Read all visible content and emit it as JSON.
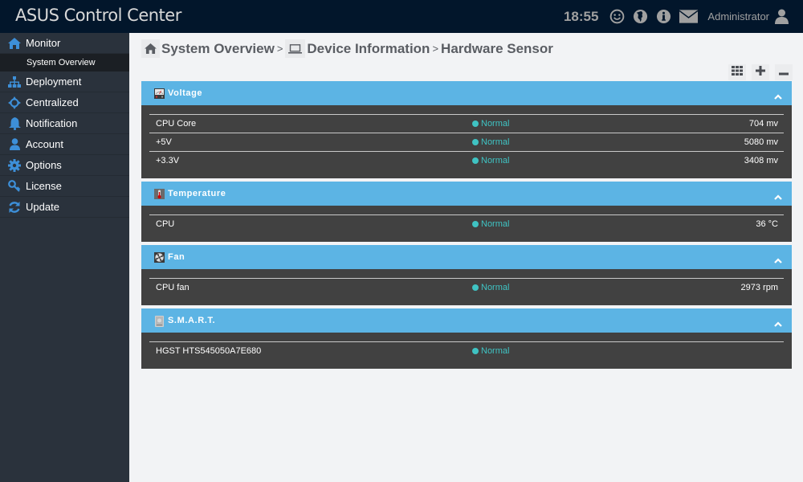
{
  "header": {
    "app_title": "ASUS Control Center",
    "clock": "18:55",
    "user": "Administrator",
    "icons": [
      "smiley-icon",
      "globe-icon",
      "info-icon",
      "mail-icon",
      "user-icon"
    ]
  },
  "sidebar": {
    "items": [
      {
        "label": "Monitor",
        "icon": "home-icon",
        "sub": [
          {
            "label": "System Overview"
          }
        ]
      },
      {
        "label": "Deployment",
        "icon": "sitemap-icon"
      },
      {
        "label": "Centralized",
        "icon": "crosshair-icon"
      },
      {
        "label": "Notification",
        "icon": "bell-icon"
      },
      {
        "label": "Account",
        "icon": "user-icon"
      },
      {
        "label": "Options",
        "icon": "gear-icon"
      },
      {
        "label": "License",
        "icon": "key-icon"
      },
      {
        "label": "Update",
        "icon": "refresh-icon"
      }
    ]
  },
  "breadcrumb": {
    "items": [
      {
        "label": "System Overview",
        "icon": "home-icon"
      },
      {
        "label": "Device Information",
        "icon": "laptop-icon"
      },
      {
        "label": "Hardware Sensor"
      }
    ],
    "separator": ">"
  },
  "toolbar": {
    "buttons": [
      {
        "name": "grid-view",
        "icon": "grid-icon"
      },
      {
        "name": "expand-all",
        "icon": "plus-icon"
      },
      {
        "name": "collapse-all",
        "icon": "minus-icon"
      }
    ]
  },
  "panels": [
    {
      "title": "Voltage",
      "icon": "voltmeter-icon",
      "rows": [
        {
          "name": "CPU Core",
          "status": "Normal",
          "value": "704 mv"
        },
        {
          "name": "+5V",
          "status": "Normal",
          "value": "5080 mv"
        },
        {
          "name": "+3.3V",
          "status": "Normal",
          "value": "3408 mv"
        }
      ]
    },
    {
      "title": "Temperature",
      "icon": "thermometer-icon",
      "rows": [
        {
          "name": "CPU",
          "status": "Normal",
          "value": "36 °C"
        }
      ]
    },
    {
      "title": "Fan",
      "icon": "fan-icon",
      "rows": [
        {
          "name": "CPU fan",
          "status": "Normal",
          "value": "2973 rpm"
        }
      ]
    },
    {
      "title": "S.M.A.R.T.",
      "icon": "harddisk-icon",
      "rows": [
        {
          "name": "HGST HTS545050A7E680",
          "status": "Normal",
          "value": ""
        }
      ]
    }
  ],
  "colors": {
    "header_bg": "#02162b",
    "sidebar_bg": "#2a323c",
    "panel_header": "#5cb4e4",
    "panel_body": "#414141",
    "status_normal": "#3fc3c3",
    "nav_icon": "#3d8fd8"
  }
}
